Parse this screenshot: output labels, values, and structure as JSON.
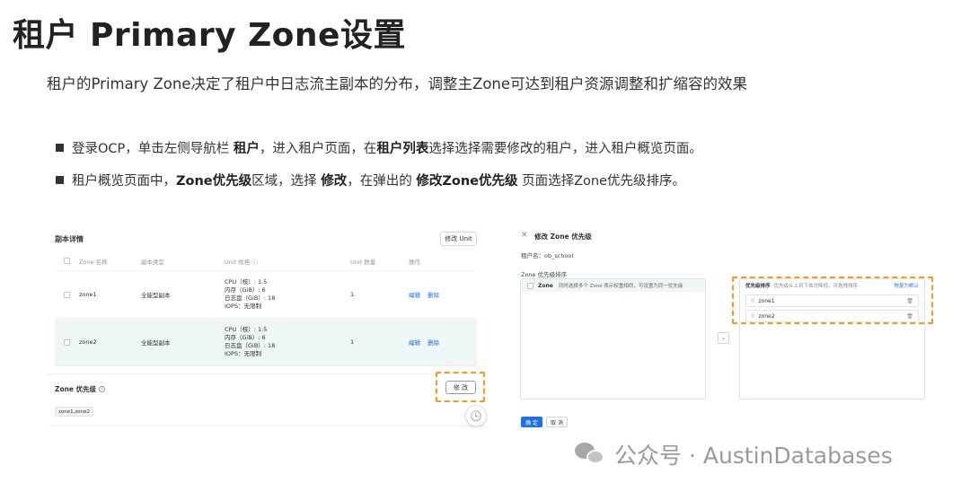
{
  "header": {
    "title": "租户 Primary Zone设置",
    "subtitle": "租户的Primary Zone决定了租户中日志流主副本的分布，调整主Zone可达到租户资源调整和扩缩容的效果"
  },
  "bullets": [
    {
      "t1": "登录OCP，单击左侧导航栏 ",
      "b1": "租户",
      "t2": "，进入租户页面，在",
      "b2": "租户列表",
      "t3": "选择选择需要修改的租户，进入租户概览页面。"
    },
    {
      "t1": "租户概览页面中，",
      "b1": "Zone优先级",
      "t2": "区域，选择 ",
      "b2": "修改",
      "t3": "，在弹出的 ",
      "b3": "修改Zone优先级",
      "t4": " 页面选择Zone优先级排序。"
    }
  ],
  "replica_panel": {
    "title": "副本详情",
    "modify_unit_button": "修改 Unit",
    "columns": [
      "Zone 名称",
      "副本类型",
      "Unit 规格 ⓘ",
      "Unit 数量",
      "操作"
    ],
    "rows": [
      {
        "zone": "zone1",
        "type": "全能型副本",
        "spec": [
          "CPU（核）: 1.5",
          "内存（GiB）: 6",
          "日志盘（GiB）: 18",
          "IOPS：无限制"
        ],
        "count": "1",
        "edit": "编辑",
        "delete": "删除"
      },
      {
        "zone": "zone2",
        "type": "全能型副本",
        "spec": [
          "CPU（核）: 1.5",
          "内存（GiB）: 6",
          "日志盘（GiB）: 18",
          "IOPS：无限制"
        ],
        "count": "1",
        "edit": "编辑",
        "delete": "删除"
      }
    ],
    "zone_priority_title": "Zone 优先级",
    "zone_priority_value": "zone1,zone2",
    "modify_button": "修 改"
  },
  "modal": {
    "title": "修改 Zone 优先级",
    "tenant_label": "租户名：ob_school",
    "zone_order_label": "Zone 优先级排序",
    "left_head_label": "Zone",
    "left_head_hint": "同时选择多个 Zone 表示权重相同，可设置为同一优先级",
    "right_head_label": "优先级排序",
    "right_head_hint": "优先级从上到下依次降低。可拖拽排序",
    "reset_label": "恢复为默认",
    "zones": [
      "zone1",
      "zone2"
    ],
    "arrow": "›",
    "ok_button": "确 定",
    "cancel_button": "取 消"
  },
  "watermark": {
    "text": "公众号 · AustinDatabases"
  },
  "colors": {
    "accent": "#1f6fe8",
    "highlight_dash": "#f29b1f",
    "row_highlight": "#eef7f5"
  }
}
